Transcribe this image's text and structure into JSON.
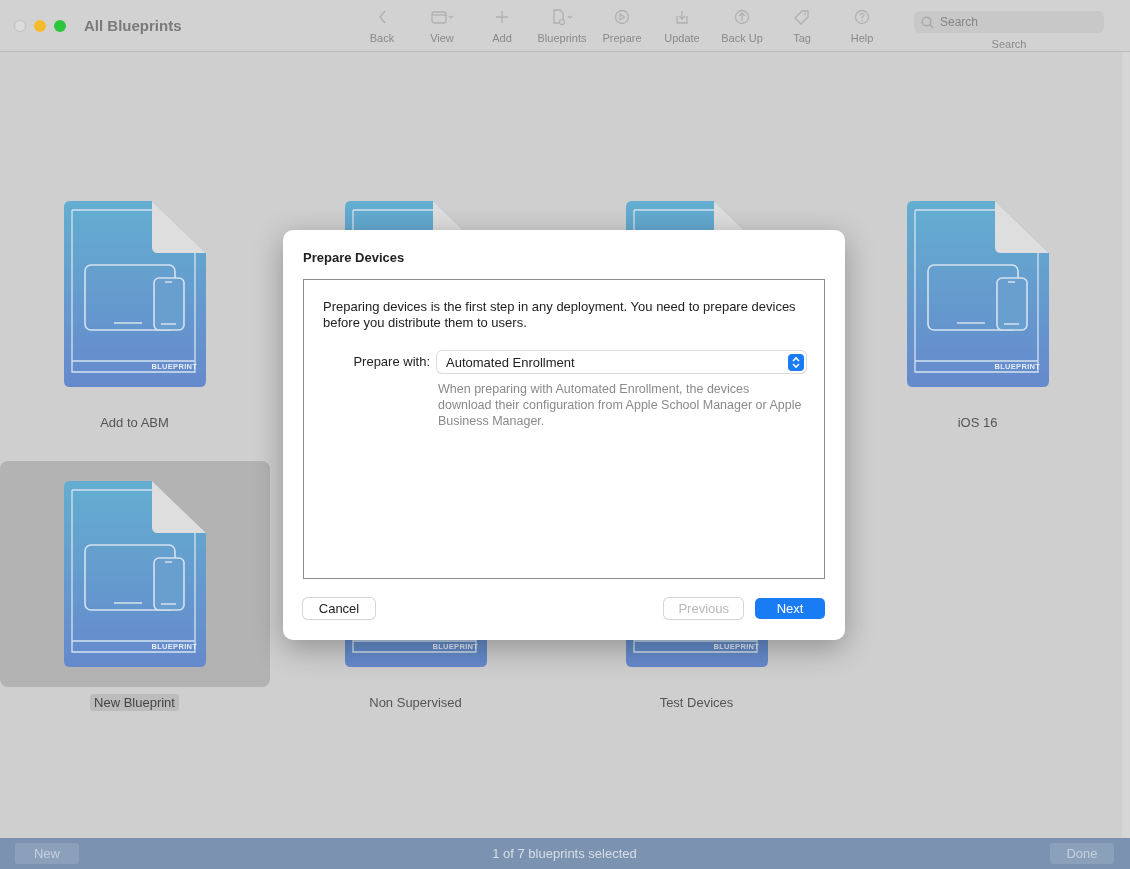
{
  "window": {
    "title": "All Blueprints"
  },
  "toolbar": [
    {
      "label": "Back",
      "kind": "back"
    },
    {
      "label": "View",
      "kind": "view"
    },
    {
      "label": "Add",
      "kind": "add"
    },
    {
      "label": "Blueprints",
      "kind": "blueprints"
    },
    {
      "label": "Prepare",
      "kind": "prepare"
    },
    {
      "label": "Update",
      "kind": "update"
    },
    {
      "label": "Back Up",
      "kind": "backup"
    },
    {
      "label": "Tag",
      "kind": "tag"
    },
    {
      "label": "Help",
      "kind": "help"
    }
  ],
  "search": {
    "placeholder": "Search",
    "label": "Search"
  },
  "blueprints": [
    {
      "name": "Add to ABM",
      "tag": "BLUEPRINT",
      "selected": false
    },
    {
      "selected": false
    },
    {
      "selected": false
    },
    {
      "name": "iOS 16",
      "tag": "BLUEPRINT",
      "selected": false
    },
    {
      "name": "New Blueprint",
      "tag": "BLUEPRINT",
      "selected": true
    },
    {
      "name": "Non Supervised",
      "tag": "BLUEPRINT",
      "selected": false
    },
    {
      "name": "Test Devices",
      "tag": "BLUEPRINT",
      "selected": false
    }
  ],
  "dialog": {
    "title": "Prepare Devices",
    "intro": "Preparing devices is the first step in any deployment. You need to prepare devices before you distribute them to users.",
    "prepare_label": "Prepare with:",
    "prepare_value": "Automated Enrollment",
    "help": "When preparing with Automated Enrollment, the devices download their configuration from Apple School Manager or Apple Business Manager.",
    "buttons": [
      {
        "label": "Cancel",
        "kind": "cancel",
        "disabled": false
      },
      {
        "label": "Previous",
        "kind": "previous",
        "disabled": true
      },
      {
        "label": "Next",
        "kind": "next",
        "disabled": false
      }
    ]
  },
  "footer": {
    "new_button": "New",
    "status": "1 of 7 blueprints selected",
    "done_button": "Done"
  }
}
